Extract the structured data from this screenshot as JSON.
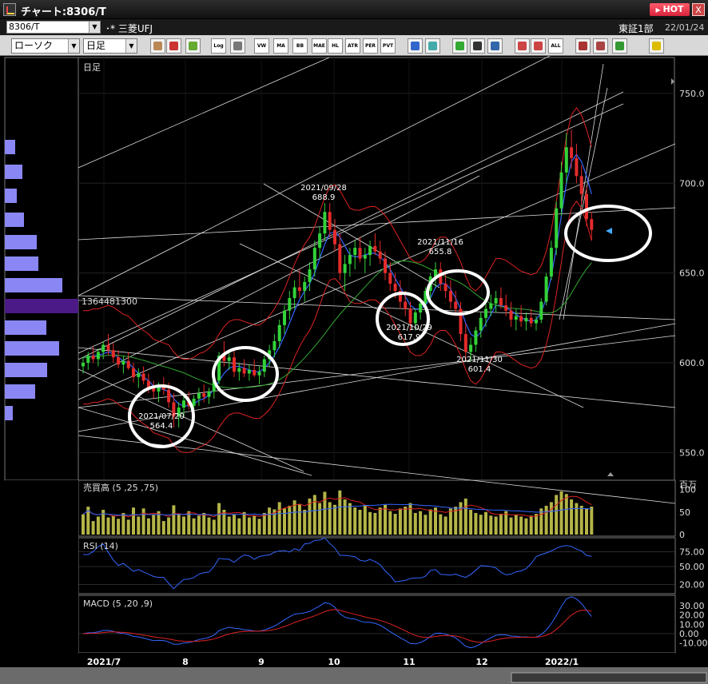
{
  "window": {
    "title": "チャート:8306/T",
    "hot_label": "HOT",
    "close_label": "X"
  },
  "symbolbar": {
    "symbol": "8306/T",
    "stock_name": "･* 三菱UFJ",
    "market": "東証1部",
    "date": "22/01/24"
  },
  "toolbar": {
    "chart_type": "ローソク",
    "period": "日足",
    "buttons": [
      "gear",
      "candle-color",
      "palette",
      "Log",
      "grid",
      "VWAP",
      "MA",
      "BB",
      "MAE",
      "HL",
      "ATR",
      "PER",
      "PVT",
      "search",
      "window",
      "pen",
      "cursor",
      "undo",
      "candle",
      "candle2",
      "ALL",
      "download",
      "zoom",
      "excel",
      "warning"
    ]
  },
  "chart_data": {
    "type": "candlestick",
    "price_panel": {
      "title": "日足",
      "y_ticks": [
        "750.0",
        "700.0",
        "650.0",
        "600.0",
        "550.0"
      ],
      "ylim": [
        535,
        770
      ],
      "volume_profile_label": "1364481300",
      "annotations": [
        {
          "date": "2021/07/20",
          "value": "564.4"
        },
        {
          "date": "2021/09/28",
          "value": "688.9"
        },
        {
          "date": "2021/10/29",
          "value": "617.9"
        },
        {
          "date": "2021/11/16",
          "value": "655.8"
        },
        {
          "date": "2021/11/30",
          "value": "601.4"
        }
      ],
      "candles": [
        [
          598,
          603,
          594,
          600
        ],
        [
          600,
          606,
          596,
          604
        ],
        [
          604,
          609,
          600,
          602
        ],
        [
          602,
          608,
          598,
          606
        ],
        [
          606,
          612,
          602,
          610
        ],
        [
          610,
          616,
          604,
          607
        ],
        [
          607,
          611,
          600,
          603
        ],
        [
          603,
          607,
          597,
          599
        ],
        [
          599,
          604,
          594,
          601
        ],
        [
          601,
          606,
          596,
          597
        ],
        [
          597,
          600,
          589,
          592
        ],
        [
          592,
          597,
          586,
          594
        ],
        [
          594,
          598,
          588,
          590
        ],
        [
          590,
          594,
          583,
          586
        ],
        [
          586,
          590,
          580,
          584
        ],
        [
          584,
          589,
          578,
          587
        ],
        [
          587,
          592,
          582,
          585
        ],
        [
          585,
          589,
          575,
          578
        ],
        [
          578,
          583,
          564,
          570
        ],
        [
          570,
          578,
          564,
          575
        ],
        [
          575,
          582,
          570,
          579
        ],
        [
          579,
          584,
          574,
          576
        ],
        [
          576,
          582,
          572,
          580
        ],
        [
          580,
          586,
          576,
          583
        ],
        [
          583,
          588,
          578,
          581
        ],
        [
          581,
          586,
          577,
          584
        ],
        [
          584,
          592,
          580,
          590
        ],
        [
          590,
          606,
          588,
          604
        ],
        [
          604,
          612,
          598,
          601
        ],
        [
          601,
          607,
          596,
          603
        ],
        [
          603,
          607,
          592,
          595
        ],
        [
          595,
          600,
          590,
          597
        ],
        [
          597,
          602,
          592,
          594
        ],
        [
          594,
          599,
          590,
          596
        ],
        [
          596,
          602,
          592,
          593
        ],
        [
          593,
          598,
          588,
          595
        ],
        [
          595,
          604,
          592,
          602
        ],
        [
          602,
          610,
          598,
          607
        ],
        [
          607,
          616,
          603,
          612
        ],
        [
          612,
          624,
          608,
          621
        ],
        [
          621,
          632,
          616,
          629
        ],
        [
          629,
          640,
          624,
          636
        ],
        [
          636,
          646,
          630,
          642
        ],
        [
          642,
          652,
          636,
          640
        ],
        [
          640,
          648,
          634,
          645
        ],
        [
          645,
          656,
          640,
          652
        ],
        [
          652,
          668,
          648,
          664
        ],
        [
          664,
          676,
          658,
          672
        ],
        [
          672,
          689,
          668,
          684
        ],
        [
          684,
          689,
          670,
          674
        ],
        [
          674,
          680,
          662,
          666
        ],
        [
          666,
          672,
          646,
          650
        ],
        [
          650,
          660,
          640,
          655
        ],
        [
          655,
          664,
          648,
          660
        ],
        [
          660,
          668,
          652,
          664
        ],
        [
          664,
          670,
          656,
          658
        ],
        [
          658,
          664,
          650,
          660
        ],
        [
          660,
          668,
          654,
          665
        ],
        [
          665,
          672,
          660,
          662
        ],
        [
          662,
          668,
          655,
          658
        ],
        [
          658,
          662,
          646,
          650
        ],
        [
          650,
          656,
          640,
          644
        ],
        [
          644,
          650,
          636,
          640
        ],
        [
          640,
          646,
          630,
          634
        ],
        [
          634,
          640,
          626,
          630
        ],
        [
          630,
          634,
          618,
          622
        ],
        [
          622,
          630,
          618,
          628
        ],
        [
          628,
          636,
          624,
          633
        ],
        [
          633,
          642,
          628,
          640
        ],
        [
          640,
          650,
          636,
          648
        ],
        [
          648,
          656,
          642,
          652
        ],
        [
          652,
          656,
          640,
          644
        ],
        [
          644,
          650,
          636,
          640
        ],
        [
          640,
          646,
          630,
          634
        ],
        [
          634,
          640,
          626,
          630
        ],
        [
          630,
          634,
          612,
          616
        ],
        [
          616,
          622,
          602,
          606
        ],
        [
          606,
          614,
          601,
          610
        ],
        [
          610,
          620,
          606,
          618
        ],
        [
          618,
          628,
          614,
          625
        ],
        [
          625,
          634,
          620,
          630
        ],
        [
          630,
          638,
          626,
          633
        ],
        [
          633,
          640,
          628,
          636
        ],
        [
          636,
          642,
          630,
          632
        ],
        [
          632,
          638,
          626,
          629
        ],
        [
          629,
          634,
          620,
          624
        ],
        [
          624,
          630,
          618,
          626
        ],
        [
          626,
          632,
          620,
          623
        ],
        [
          623,
          628,
          618,
          625
        ],
        [
          625,
          630,
          620,
          622
        ],
        [
          622,
          626,
          618,
          624
        ],
        [
          624,
          636,
          622,
          634
        ],
        [
          634,
          650,
          632,
          648
        ],
        [
          648,
          668,
          646,
          664
        ],
        [
          664,
          690,
          660,
          686
        ],
        [
          686,
          712,
          682,
          706
        ],
        [
          706,
          728,
          700,
          720
        ],
        [
          720,
          730,
          708,
          714
        ],
        [
          714,
          722,
          700,
          704
        ],
        [
          704,
          710,
          688,
          694
        ],
        [
          694,
          698,
          676,
          680
        ],
        [
          680,
          684,
          668,
          674
        ]
      ],
      "ma_short": [
        603,
        603,
        604,
        604,
        605,
        606,
        605,
        603,
        601,
        600,
        597,
        594,
        592,
        590,
        587,
        586,
        585,
        584,
        580,
        577,
        576,
        576,
        577,
        579,
        580,
        582,
        585,
        590,
        594,
        597,
        598,
        598,
        597,
        596,
        595,
        595,
        597,
        600,
        604,
        609,
        615,
        622,
        629,
        635,
        640,
        644,
        650,
        658,
        666,
        672,
        673,
        670,
        665,
        660,
        659,
        659,
        660,
        661,
        661,
        659,
        656,
        652,
        647,
        642,
        637,
        632,
        630,
        630,
        632,
        636,
        642,
        644,
        644,
        641,
        636,
        630,
        622,
        616,
        614,
        617,
        622,
        627,
        632,
        632,
        631,
        629,
        627,
        625,
        624,
        623,
        624,
        628,
        636,
        648,
        664,
        682,
        700,
        712,
        716,
        712,
        704,
        694
      ]
    },
    "volume_panel": {
      "title": "売買高 (5 ,25 ,75)",
      "unit": "百万",
      "y_ticks": [
        "100",
        "50",
        "0"
      ],
      "values": [
        45,
        62,
        30,
        40,
        55,
        38,
        42,
        35,
        48,
        33,
        60,
        40,
        58,
        36,
        44,
        52,
        30,
        38,
        65,
        47,
        40,
        52,
        36,
        42,
        48,
        38,
        33,
        70,
        55,
        40,
        44,
        36,
        50,
        38,
        42,
        35,
        48,
        60,
        56,
        72,
        58,
        64,
        76,
        68,
        55,
        80,
        88,
        70,
        95,
        72,
        66,
        98,
        78,
        70,
        60,
        55,
        64,
        50,
        48,
        60,
        66,
        52,
        46,
        58,
        62,
        70,
        48,
        52,
        44,
        56,
        60,
        45,
        40,
        58,
        62,
        72,
        80,
        55,
        48,
        44,
        50,
        42,
        40,
        46,
        52,
        38,
        44,
        40,
        36,
        42,
        46,
        58,
        64,
        72,
        88,
        96,
        90,
        78,
        70,
        64,
        58,
        62
      ]
    },
    "rsi_panel": {
      "title": "RSI (14)",
      "y_ticks": [
        "75.00",
        "50.00",
        "20.00"
      ]
    },
    "macd_panel": {
      "title": "MACD (5 ,20 ,9)",
      "y_ticks": [
        "30.00",
        "20.00",
        "10.00",
        "0.00",
        "-10.00"
      ]
    },
    "x_ticks": [
      "2021/7",
      "8",
      "9",
      "10",
      "11",
      "12",
      "2022/1"
    ]
  }
}
